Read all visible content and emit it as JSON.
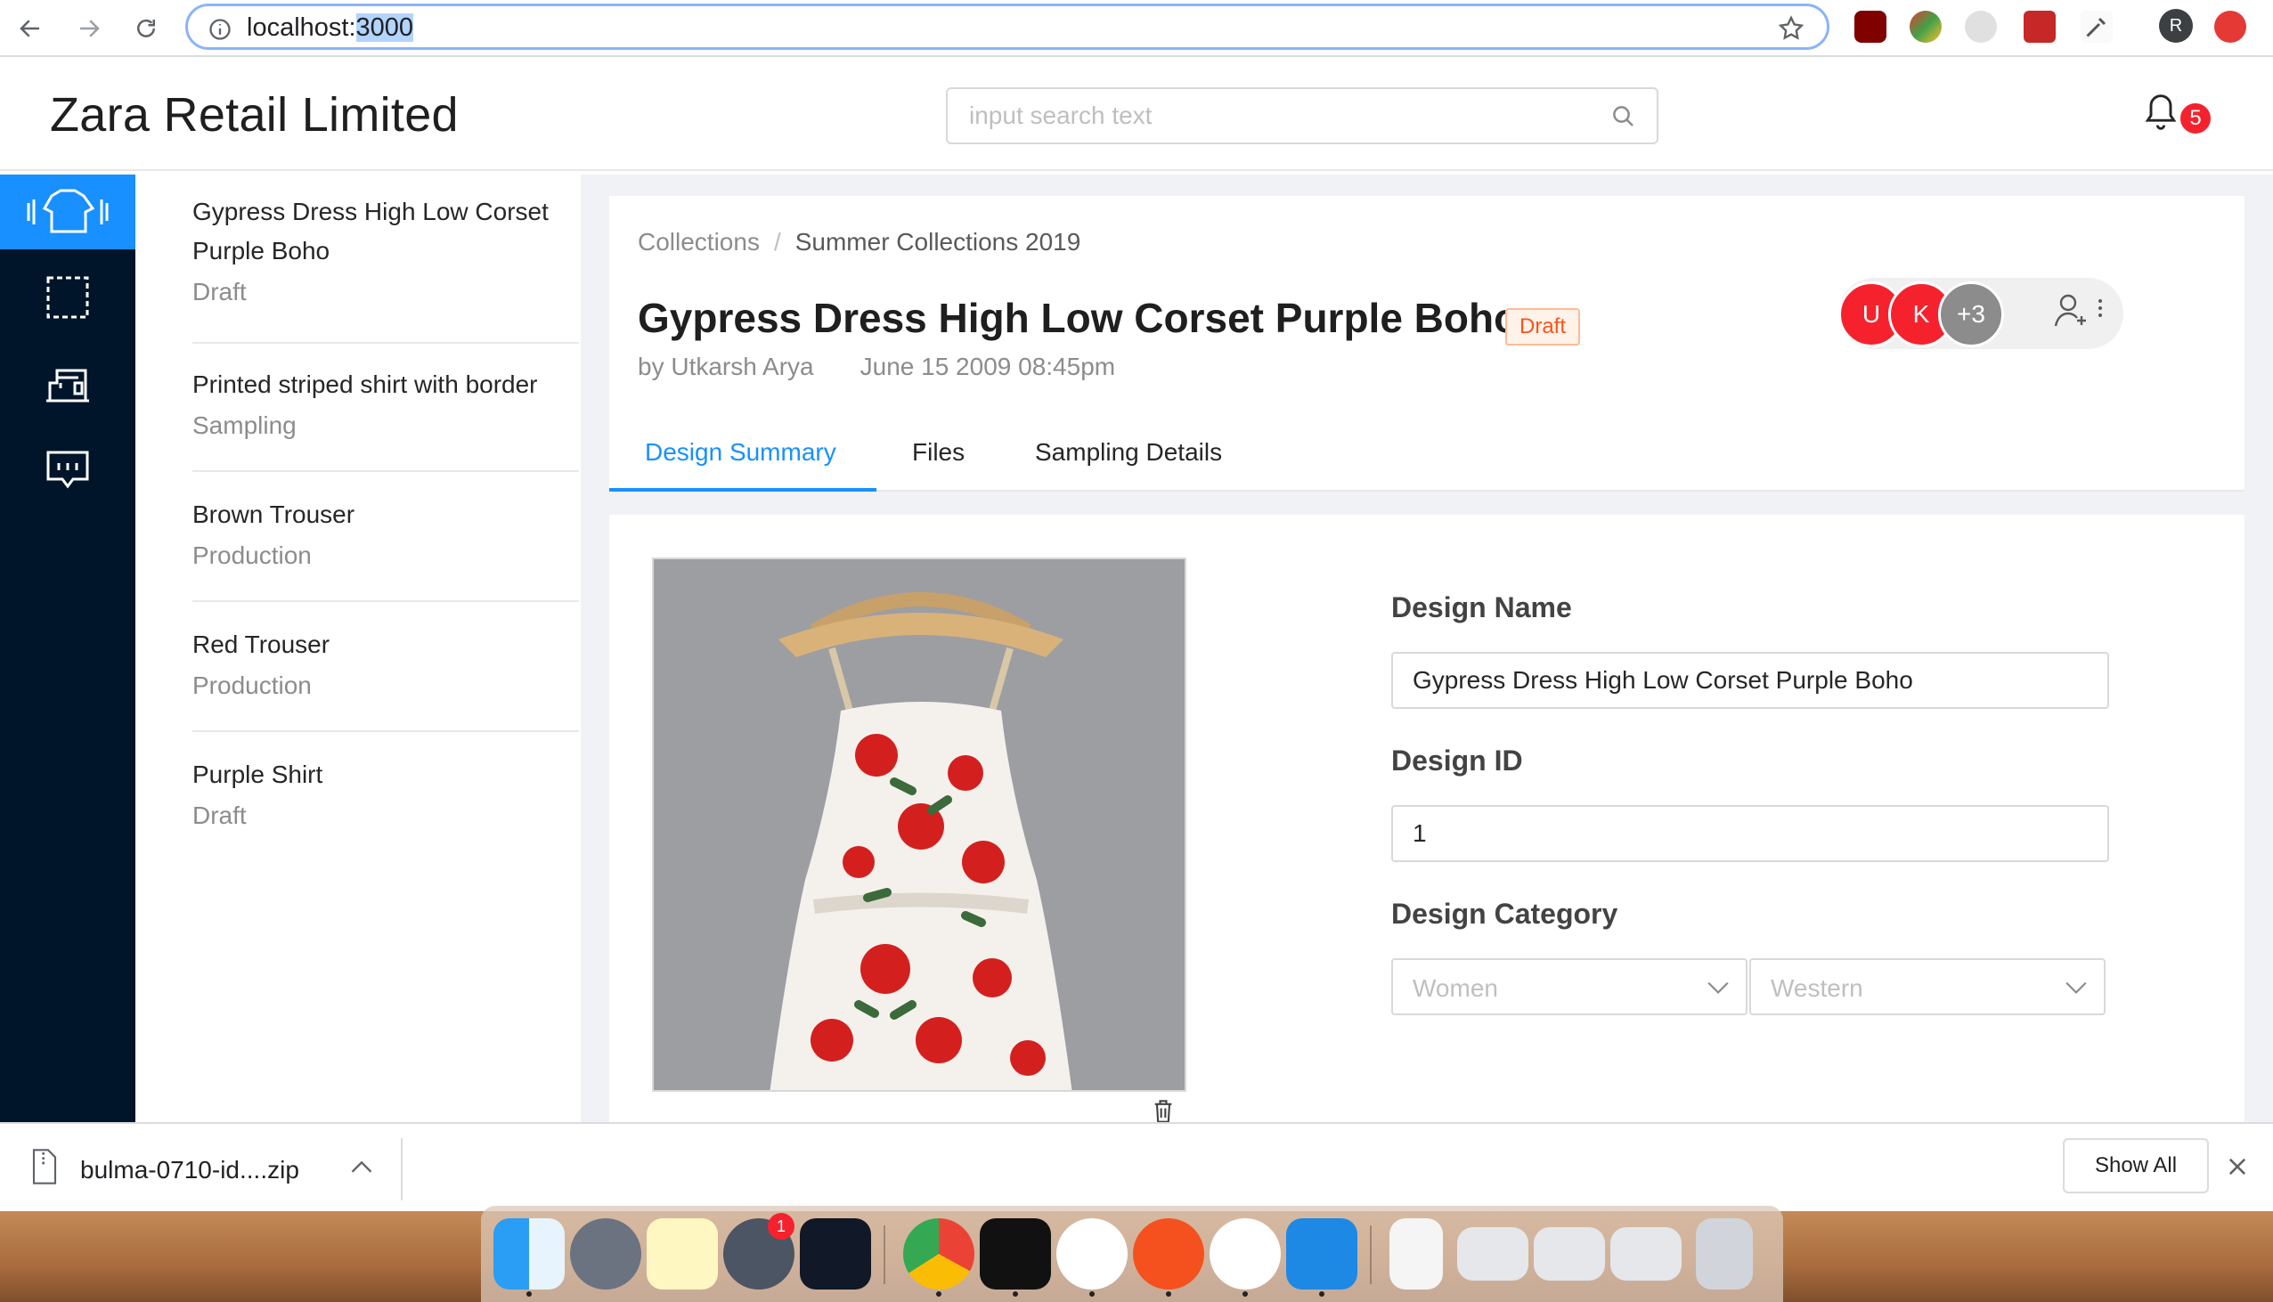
{
  "browser": {
    "url_host": "localhost:",
    "url_port": "3000",
    "profile_initial": "R"
  },
  "header": {
    "brand": "Zara Retail Limited",
    "search_placeholder": "input search text",
    "notification_count": "5"
  },
  "sidebar_icons": [
    "apparel-icon",
    "fabric-icon",
    "sewing-machine-icon",
    "message-icon"
  ],
  "design_list": [
    {
      "title": "Gypress Dress High Low Corset Purple Boho",
      "status": "Draft"
    },
    {
      "title": "Printed striped shirt with border",
      "status": "Sampling"
    },
    {
      "title": "Brown Trouser",
      "status": "Production"
    },
    {
      "title": "Red Trouser",
      "status": "Production"
    },
    {
      "title": "Purple Shirt",
      "status": "Draft"
    }
  ],
  "detail": {
    "breadcrumb": [
      "Collections",
      "Summer Collections 2019"
    ],
    "breadcrumb_separator": "/",
    "title": "Gypress Dress High Low Corset Purple Boho",
    "status_tag": "Draft",
    "author": "by Utkarsh Arya",
    "date": "June 15 2009 08:45pm",
    "avatars": [
      {
        "initial": "U",
        "color": "#f5222d"
      },
      {
        "initial": "K",
        "color": "#f5222d"
      },
      {
        "initial": "+3",
        "color": "#8c8c8c"
      }
    ],
    "tabs": [
      {
        "label": "Design Summary",
        "active": true
      },
      {
        "label": "Files",
        "active": false
      },
      {
        "label": "Sampling Details",
        "active": false
      }
    ]
  },
  "form": {
    "design_name_label": "Design Name",
    "design_name_value": "Gypress Dress High Low Corset Purple Boho",
    "design_id_label": "Design ID",
    "design_id_value": "1",
    "design_category_label": "Design Category",
    "category_1": "Women",
    "category_2": "Western"
  },
  "download_shelf": {
    "file_name": "bulma-0710-id....zip",
    "show_all": "Show All"
  },
  "dock": {
    "apps": [
      "finder-icon",
      "launchpad-icon",
      "notes-icon",
      "system-preferences-icon",
      "pycharm-icon",
      "chrome-icon",
      "terminal-icon",
      "slack-icon",
      "paw-icon",
      "bear-icon",
      "vscode-icon",
      "archive-icon",
      "screenshot-1-icon",
      "screenshot-2-icon",
      "screenshot-3-icon",
      "trash-icon"
    ],
    "system_preferences_badge": "1"
  },
  "colors": {
    "primary": "#1890ff",
    "sidebar": "#001529",
    "danger": "#f5222d",
    "draft_tag": "#fa541c"
  }
}
